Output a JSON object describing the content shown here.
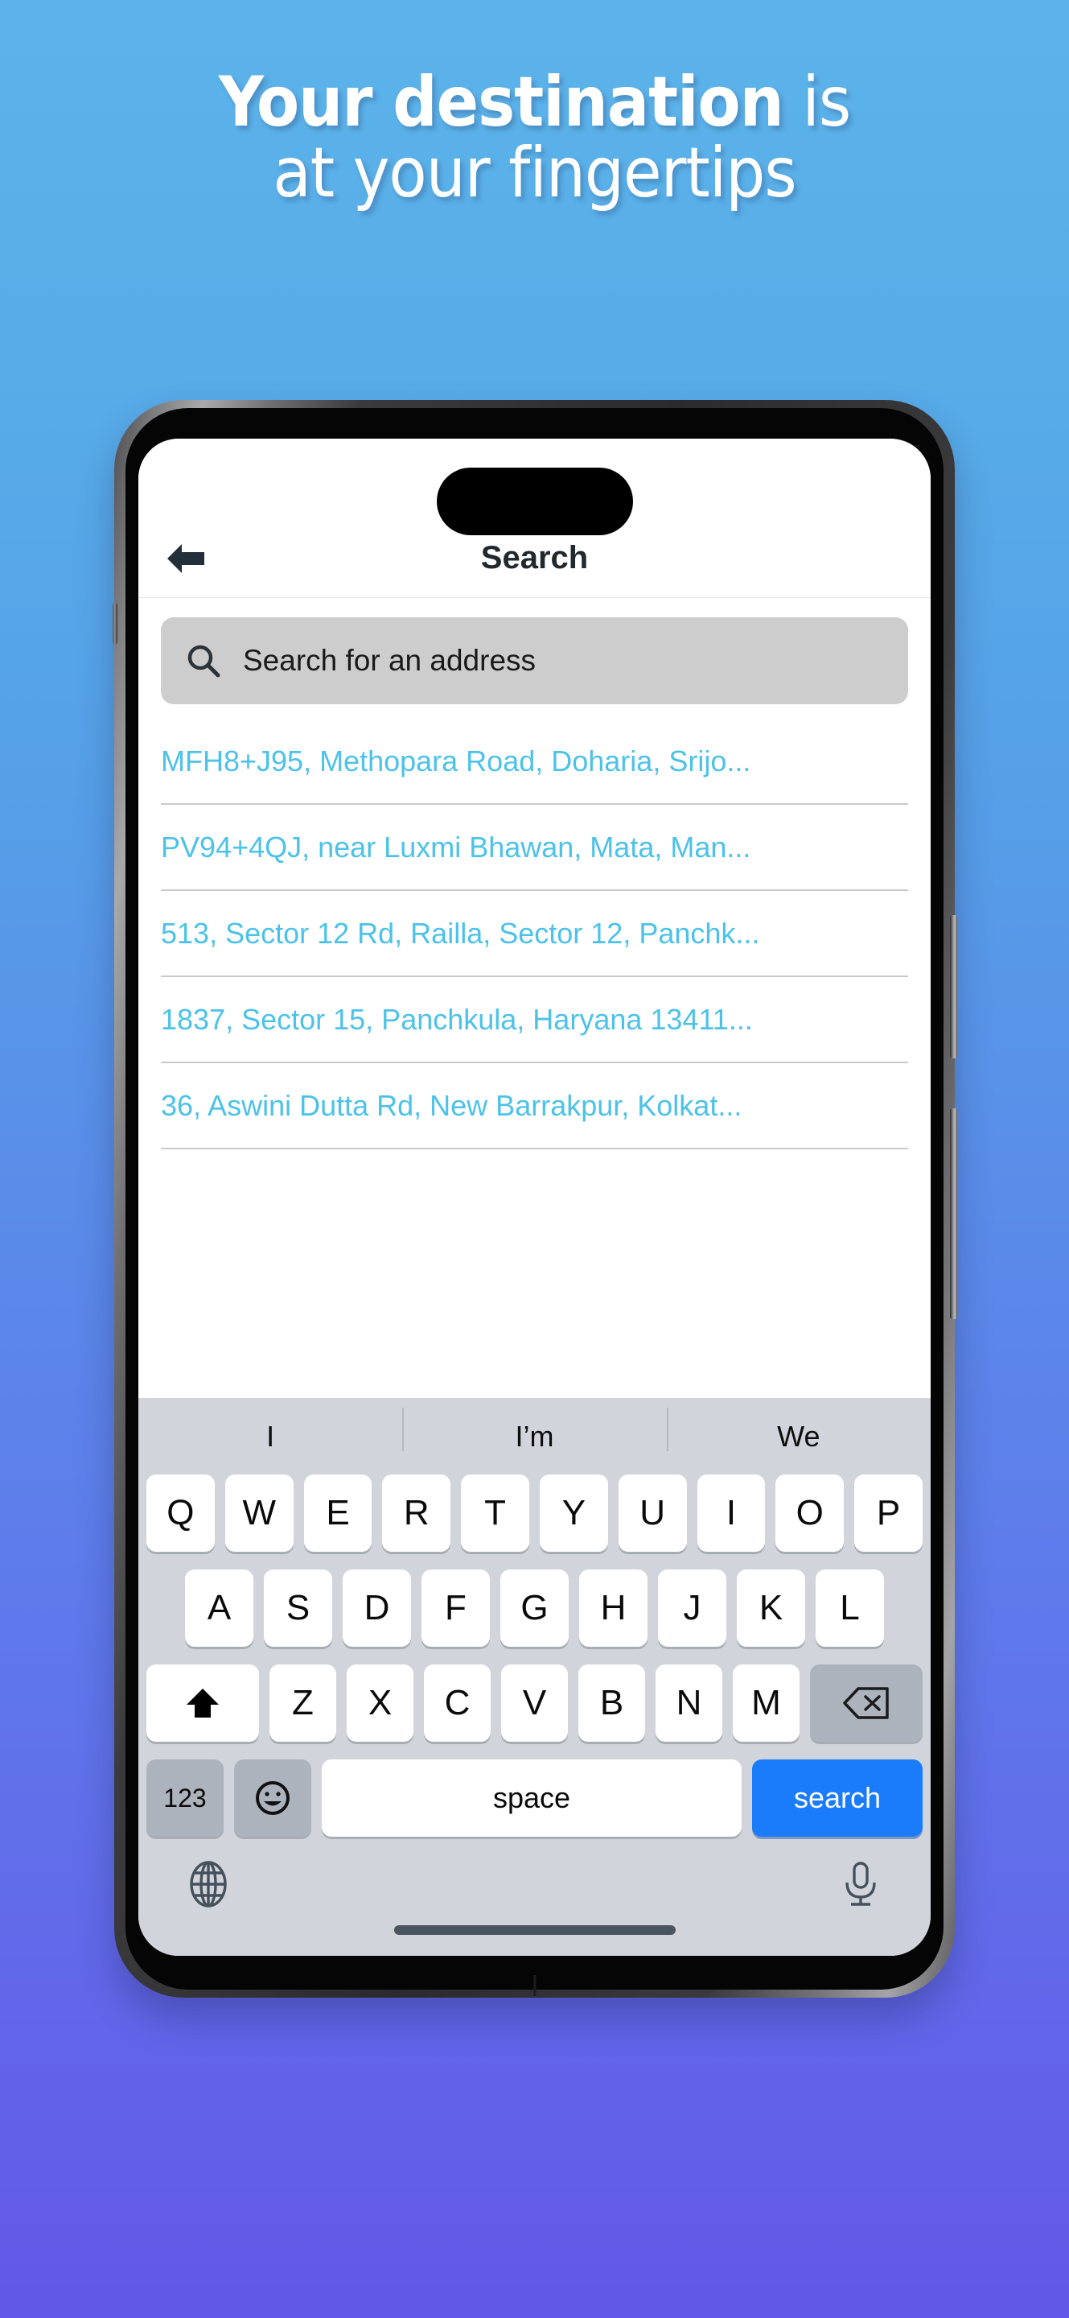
{
  "promo": {
    "headline_line1_strong": "Your destination",
    "headline_line1_rest": " is",
    "headline_line2": "at your fingertips"
  },
  "colors": {
    "background_top": "#5cb3e9",
    "background_bottom": "#6257e8",
    "result_text": "#4cc2e8",
    "search_key": "#1a7cfb",
    "searchbar_fill": "#cdcdcd",
    "keyboard_bg": "#d1d5db"
  },
  "app": {
    "appbar": {
      "back_label": "back-arrow",
      "title": "Search"
    },
    "search": {
      "placeholder": "Search for an address",
      "value": "",
      "icon": "search-icon"
    },
    "results": [
      {
        "text": "MFH8+J95, Methopara Road, Doharia, Srijo..."
      },
      {
        "text": "PV94+4QJ, near Luxmi Bhawan, Mata, Man..."
      },
      {
        "text": "513, Sector 12 Rd, Railla, Sector 12, Panchk..."
      },
      {
        "text": "1837, Sector 15, Panchkula, Haryana 13411..."
      },
      {
        "text": "36, Aswini Dutta Rd, New Barrakpur, Kolkat..."
      }
    ]
  },
  "keyboard": {
    "suggestions": [
      "I",
      "I’m",
      "We"
    ],
    "row1": [
      "Q",
      "W",
      "E",
      "R",
      "T",
      "Y",
      "U",
      "I",
      "O",
      "P"
    ],
    "row2": [
      "A",
      "S",
      "D",
      "F",
      "G",
      "H",
      "J",
      "K",
      "L"
    ],
    "row3": [
      "Z",
      "X",
      "C",
      "V",
      "B",
      "N",
      "M"
    ],
    "shift_label": "shift-icon",
    "backspace_label": "backspace-icon",
    "numeric_label": "123",
    "emoji_label": "emoji-icon",
    "space_label": "space",
    "search_label": "search",
    "globe_label": "globe-icon",
    "mic_label": "microphone-icon"
  }
}
